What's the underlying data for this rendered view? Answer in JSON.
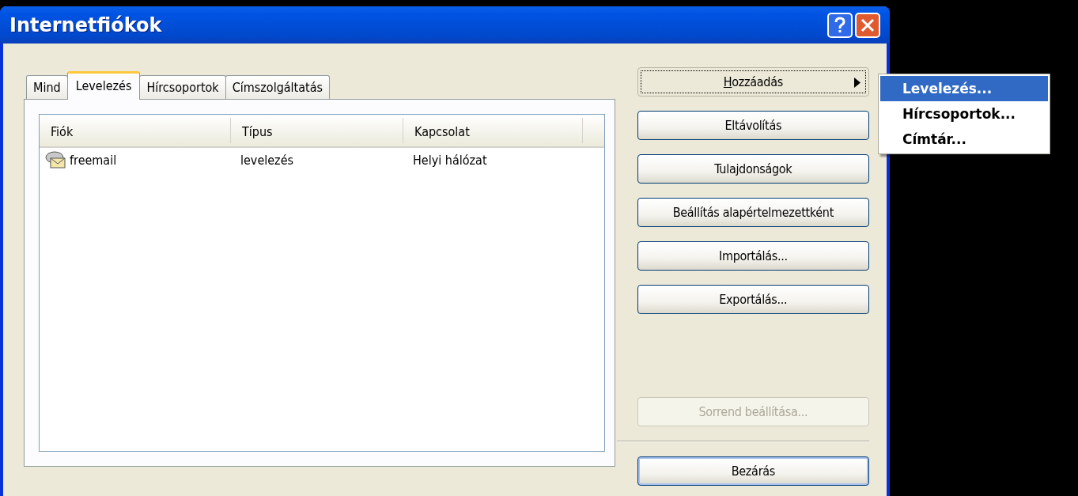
{
  "window": {
    "title": "Internetfiókok"
  },
  "tabs": [
    {
      "label": "Mind",
      "selected": false
    },
    {
      "label": "Levelezés",
      "selected": true
    },
    {
      "label": "Hírcsoportok",
      "selected": false
    },
    {
      "label": "Címszolgáltatás",
      "selected": false
    }
  ],
  "table": {
    "columns": [
      "Fiók",
      "Típus",
      "Kapcsolat"
    ],
    "rows": [
      {
        "cells": [
          "freemail",
          "levelezés",
          "Helyi hálózat"
        ]
      }
    ]
  },
  "buttons": [
    {
      "label": "Hozzáadás",
      "kind": "submenu",
      "focused": true,
      "mnemonic": true,
      "disabled": false
    },
    {
      "label": "Eltávolítás",
      "kind": "plain",
      "focused": false,
      "mnemonic": false,
      "disabled": false
    },
    {
      "label": "Tulajdonságok",
      "kind": "plain",
      "focused": false,
      "mnemonic": false,
      "disabled": false
    },
    {
      "label": "Beállítás alapértelmezettként",
      "kind": "plain",
      "focused": false,
      "mnemonic": false,
      "disabled": false
    },
    {
      "label": "Importálás...",
      "kind": "plain",
      "focused": false,
      "mnemonic": false,
      "disabled": false
    },
    {
      "label": "Exportálás...",
      "kind": "plain",
      "focused": false,
      "mnemonic": false,
      "disabled": false
    },
    {
      "label": "Sorrend beállítása...",
      "kind": "plain",
      "focused": false,
      "mnemonic": false,
      "disabled": true
    }
  ],
  "close_button": {
    "label": "Bezárás",
    "default": true
  },
  "menu": {
    "items": [
      {
        "label": "Levelezés...",
        "selected": true
      },
      {
        "label": "Hírcsoportok...",
        "selected": false
      },
      {
        "label": "Címtár...",
        "selected": false
      }
    ]
  }
}
